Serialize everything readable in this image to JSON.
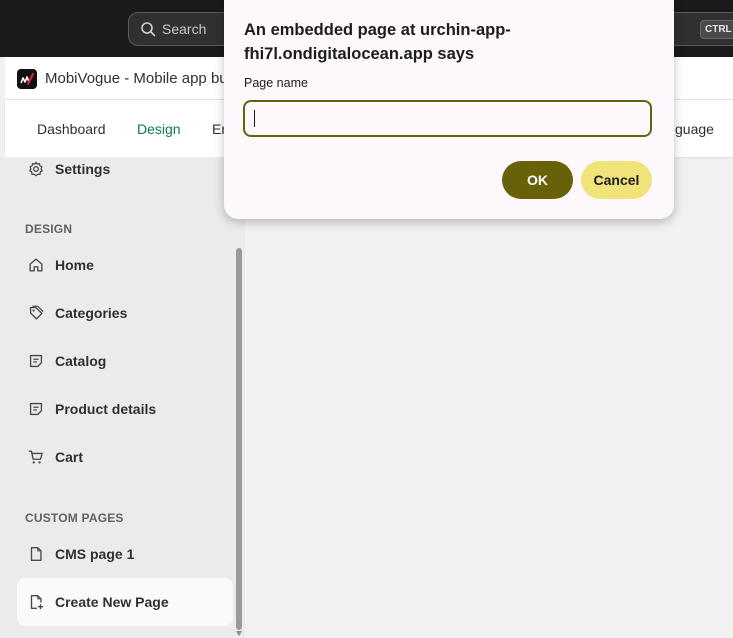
{
  "topbar": {
    "search_placeholder": "Search",
    "shortcut_key": "CTRL"
  },
  "app": {
    "title": "MobiVogue - Mobile app bu"
  },
  "nav": {
    "tabs": [
      {
        "label": "Dashboard"
      },
      {
        "label": "Design"
      },
      {
        "label": "En"
      },
      {
        "label": "guage"
      }
    ],
    "active_color": "#0b7a5a"
  },
  "sidebar": {
    "settings_label": "Settings",
    "design_section": "DESIGN",
    "design_items": [
      {
        "label": "Home",
        "icon": "home-icon"
      },
      {
        "label": "Categories",
        "icon": "tag-icon"
      },
      {
        "label": "Catalog",
        "icon": "note-icon"
      },
      {
        "label": "Product details",
        "icon": "note-icon"
      },
      {
        "label": "Cart",
        "icon": "cart-icon"
      }
    ],
    "custom_section": "CUSTOM PAGES",
    "custom_items": [
      {
        "label": "CMS page 1",
        "icon": "page-icon"
      },
      {
        "label": "Create New Page",
        "icon": "page-add-icon"
      }
    ]
  },
  "dialog": {
    "title": "An embedded page at urchin-app-fhi7l.ondigitalocean.app says",
    "label": "Page name",
    "input_value": "",
    "ok_label": "OK",
    "cancel_label": "Cancel",
    "accent_color": "#67610a",
    "cancel_color": "#f0e37a"
  }
}
